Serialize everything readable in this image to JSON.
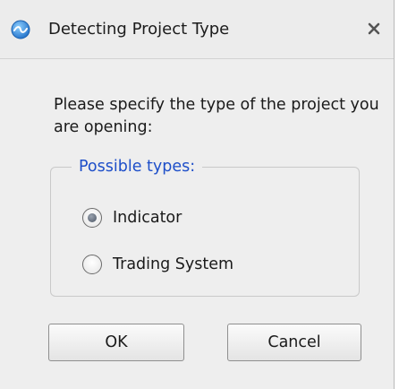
{
  "window": {
    "title": "Detecting Project Type",
    "app_icon": "wave-icon",
    "close_icon": "close-icon"
  },
  "prompt": {
    "text": "Please specify the type of the project you are opening:"
  },
  "group": {
    "legend": "Possible types:",
    "options": [
      {
        "label": "Indicator",
        "checked": true
      },
      {
        "label": "Trading System",
        "checked": false
      }
    ]
  },
  "buttons": {
    "ok_label": "OK",
    "cancel_label": "Cancel"
  },
  "colors": {
    "legend_text": "#1e4fc9",
    "icon_blue": "#2f7fd6"
  }
}
